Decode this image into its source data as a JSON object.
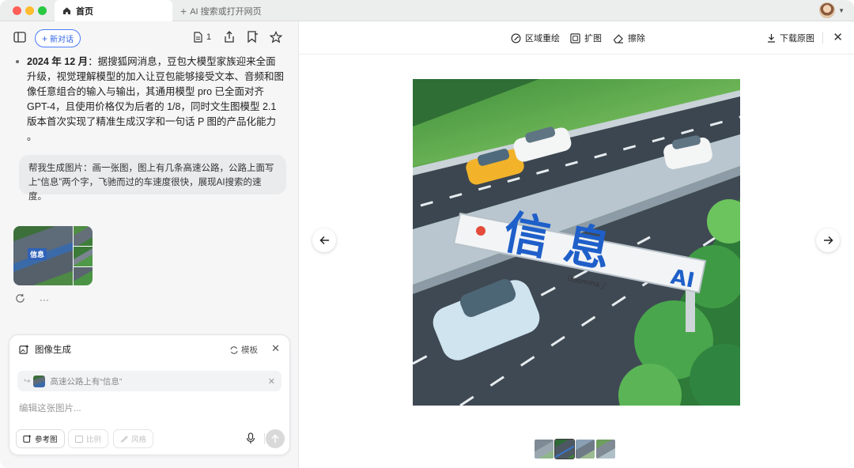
{
  "tabs": {
    "home_label": "首页",
    "new_tab_label": "AI 搜索或打开网页"
  },
  "left": {
    "new_chat_label": "新对话",
    "doc_count": "1",
    "answer_date": "2024 年 12 月",
    "answer_text": "：据搜狐网消息，豆包大模型家族迎来全面升级，视觉理解模型的加入让豆包能够接受文本、音频和图像任意组合的输入与输出，其通用模型 pro 已全面对齐 GPT-4，且使用价格仅为后者的 1/8，同时文生图模型 2.1 版本首次实现了精准生成汉字和一句话 P 图的产品化能力 。",
    "user_prompt": "帮我生成图片：画一张图，图上有几条高速公路，公路上面写上“信息”两个字，飞驰而过的车速度很快，展现AI搜索的速度。",
    "thumb_text": "信息"
  },
  "gen_card": {
    "title": "图像生成",
    "template_label": "模板",
    "reference_text": "高速公路上有“信息”",
    "placeholder": "编辑这张图片...",
    "ref_image_label": "参考图",
    "ratio_label": "比例",
    "style_label": "风格"
  },
  "right": {
    "region_redraw_label": "区域重绘",
    "expand_label": "扩图",
    "erase_label": "擦除",
    "download_label": "下载原图",
    "sign_text": "信 息",
    "sign_sub": "AI",
    "sign_caption": "\\Yoomma_/"
  },
  "colors": {
    "accent": "#2f64e6",
    "sign_blue": "#1f5fc9"
  }
}
